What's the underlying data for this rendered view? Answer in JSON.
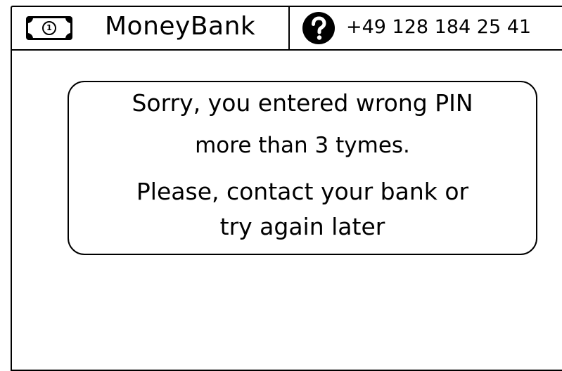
{
  "header": {
    "brand_name": "MoneyBank",
    "brand_icon": "banknote-icon",
    "brand_icon_digit": "1",
    "help_icon": "question-circle-icon",
    "phone": "+49 128 184 25 41"
  },
  "message": {
    "line1": "Sorry, you entered wrong PIN",
    "line2": "more than 3 tymes.",
    "line3": "Please, contact your bank or",
    "line4": "try again later"
  }
}
